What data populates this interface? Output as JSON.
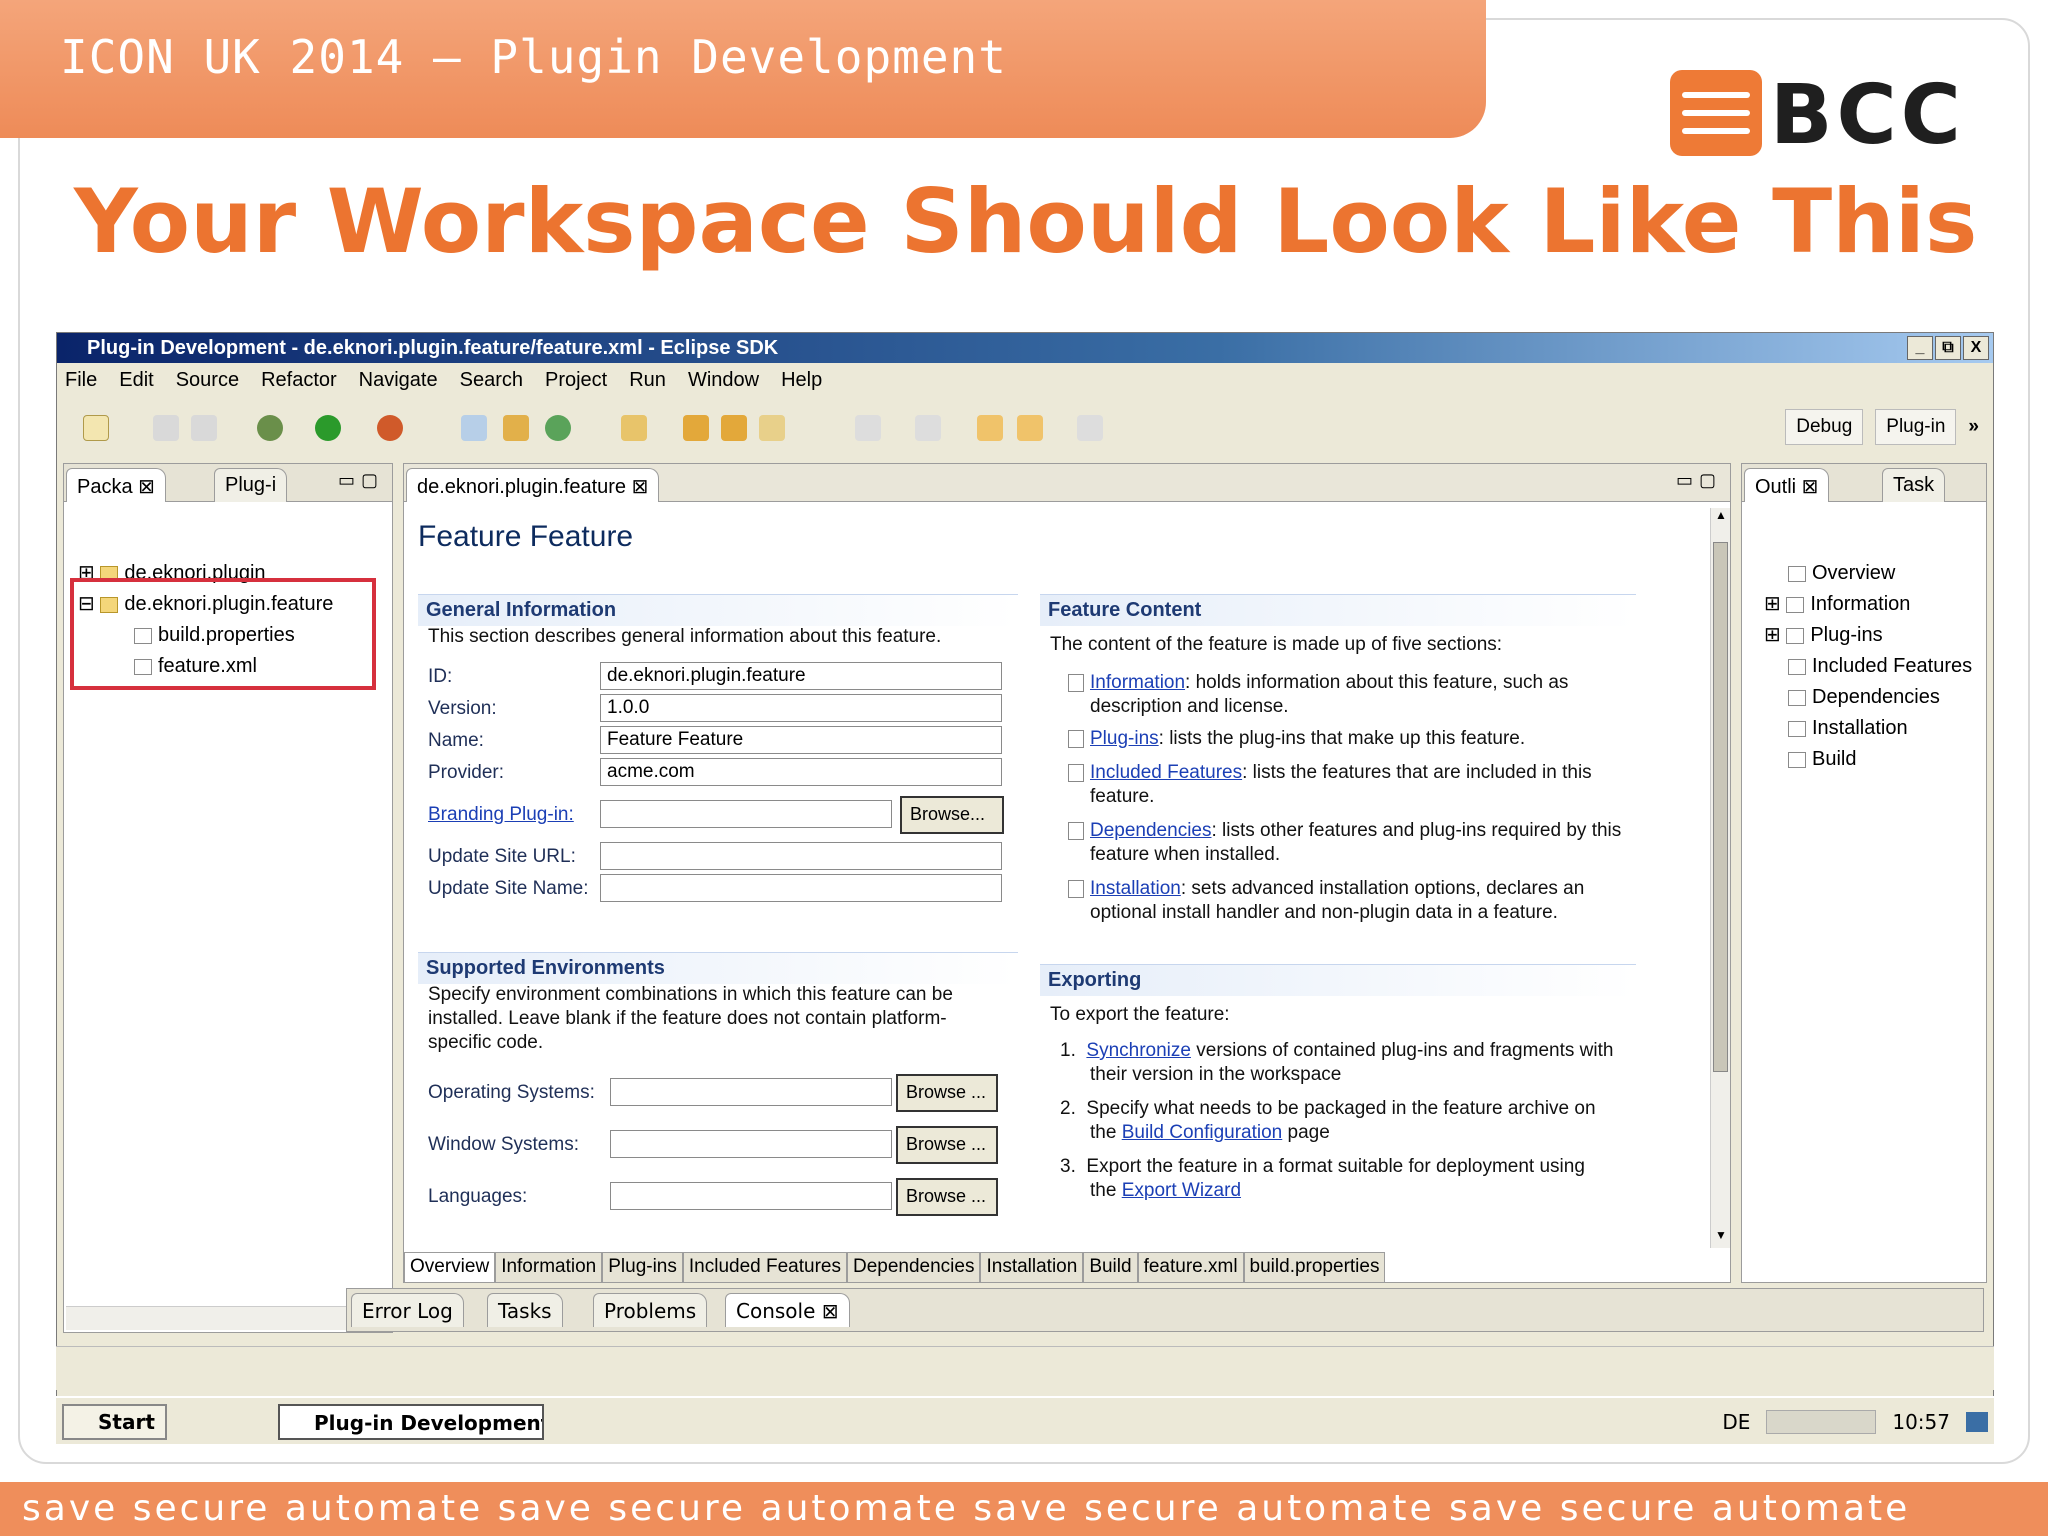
{
  "slide": {
    "header": "ICON UK  2014 – Plugin Development",
    "logo": "BCC",
    "title": "Your Workspace Should Look Like This",
    "footer": "save secure automate save secure automate save secure automate save secure automate",
    "colors": {
      "accent": "#ec7430",
      "band": "#ef8e5b"
    }
  },
  "eclipse": {
    "window_title": "Plug-in Development - de.eknori.plugin.feature/feature.xml - Eclipse SDK",
    "window_controls": [
      "_",
      "⧉",
      "X"
    ],
    "menu": [
      "File",
      "Edit",
      "Source",
      "Refactor",
      "Navigate",
      "Search",
      "Project",
      "Run",
      "Window",
      "Help"
    ],
    "perspectives": {
      "debug": "Debug",
      "plugin": "Plug-in",
      "more": "»"
    },
    "left_view": {
      "tabs": [
        "Packa",
        "Plug-i"
      ],
      "tree": [
        {
          "label": "de.eknori.plugin",
          "expander": "⊞"
        },
        {
          "label": "de.eknori.plugin.feature",
          "expander": "⊟"
        },
        {
          "label": "build.properties"
        },
        {
          "label": "feature.xml"
        }
      ]
    },
    "editor": {
      "tab": "de.eknori.plugin.feature",
      "heading": "Feature Feature",
      "general": {
        "title": "General Information",
        "desc": "This section describes general information about this feature.",
        "id_label": "ID:",
        "id_value": "de.eknori.plugin.feature",
        "version_label": "Version:",
        "version_value": "1.0.0",
        "name_label": "Name:",
        "name_value": "Feature Feature",
        "provider_label": "Provider:",
        "provider_value": "acme.com",
        "branding_label": "Branding Plug-in:",
        "browse": "Browse...",
        "update_url_label": "Update Site URL:",
        "update_name_label": "Update Site Name:"
      },
      "environments": {
        "title": "Supported Environments",
        "desc1": "Specify environment combinations in which this feature can be",
        "desc2": "installed. Leave blank if the feature does not contain platform-",
        "desc3": "specific code.",
        "os_label": "Operating Systems:",
        "ws_label": "Window Systems:",
        "lang_label": "Languages:",
        "browse": "Browse ..."
      },
      "content": {
        "title": "Feature Content",
        "intro": "The content of the feature is made up of five sections:",
        "items": [
          {
            "link": "Information",
            "text": ": holds information about this feature, such as",
            "text2": "description and license."
          },
          {
            "link": "Plug-ins",
            "text": ": lists the plug-ins that make up this feature.",
            "text2": ""
          },
          {
            "link": "Included Features",
            "text": ": lists the features that are included in this",
            "text2": "feature."
          },
          {
            "link": "Dependencies",
            "text": ": lists other features and plug-ins required by this",
            "text2": "feature when installed."
          },
          {
            "link": "Installation",
            "text": ": sets advanced installation options, declares an",
            "text2": "optional install handler and non-plugin data in a feature."
          }
        ]
      },
      "exporting": {
        "title": "Exporting",
        "intro": "To export the feature:",
        "step1_link": "Synchronize",
        "step1_text": " versions of contained plug-ins and fragments with",
        "step1_text2": "their version in the workspace",
        "step2_text": "Specify what needs to be packaged in the feature archive on",
        "step2_pre": "the ",
        "step2_link": "Build Configuration",
        "step2_post": " page",
        "step3_text": "Export the feature in a format suitable for deployment using",
        "step3_pre": "the ",
        "step3_link": "Export Wizard"
      },
      "bottom_tabs": [
        "Overview",
        "Information",
        "Plug-ins",
        "Included Features",
        "Dependencies",
        "Installation",
        "Build",
        "feature.xml",
        "build.properties"
      ]
    },
    "outline_view": {
      "tabs": [
        "Outli",
        "Task"
      ],
      "items": [
        "Overview",
        "Information",
        "Plug-ins",
        "Included Features",
        "Dependencies",
        "Installation",
        "Build"
      ]
    },
    "bottom_views": [
      "Error Log",
      "Tasks",
      "Problems",
      "Console"
    ],
    "taskbar": {
      "start": "Start",
      "task": "Plug-in Development ...",
      "lang": "DE",
      "clock": "10:57"
    }
  }
}
